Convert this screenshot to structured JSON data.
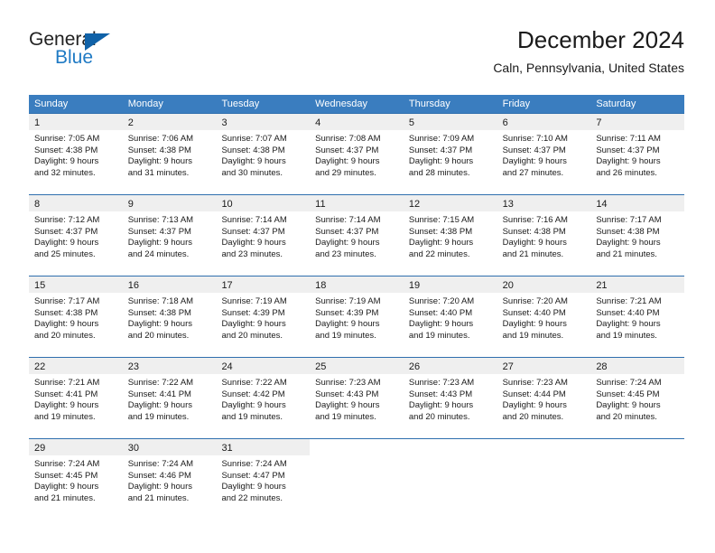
{
  "brand": {
    "name_part1": "General",
    "name_part2": "Blue",
    "triangle_icon": "triangle-logo-icon"
  },
  "header": {
    "title": "December 2024",
    "subtitle": "Caln, Pennsylvania, United States"
  },
  "colors": {
    "header_blue": "#3a7dbf",
    "rule_blue": "#2f6fae",
    "day_band_gray": "#efefef",
    "brand_blue": "#1f7ac4",
    "brand_triangle": "#1062a8",
    "text": "#1a1a1a"
  },
  "weekday_headers": [
    "Sunday",
    "Monday",
    "Tuesday",
    "Wednesday",
    "Thursday",
    "Friday",
    "Saturday"
  ],
  "weeks": [
    [
      {
        "day": "1",
        "sunrise": "Sunrise: 7:05 AM",
        "sunset": "Sunset: 4:38 PM",
        "daylight1": "Daylight: 9 hours",
        "daylight2": "and 32 minutes."
      },
      {
        "day": "2",
        "sunrise": "Sunrise: 7:06 AM",
        "sunset": "Sunset: 4:38 PM",
        "daylight1": "Daylight: 9 hours",
        "daylight2": "and 31 minutes."
      },
      {
        "day": "3",
        "sunrise": "Sunrise: 7:07 AM",
        "sunset": "Sunset: 4:38 PM",
        "daylight1": "Daylight: 9 hours",
        "daylight2": "and 30 minutes."
      },
      {
        "day": "4",
        "sunrise": "Sunrise: 7:08 AM",
        "sunset": "Sunset: 4:37 PM",
        "daylight1": "Daylight: 9 hours",
        "daylight2": "and 29 minutes."
      },
      {
        "day": "5",
        "sunrise": "Sunrise: 7:09 AM",
        "sunset": "Sunset: 4:37 PM",
        "daylight1": "Daylight: 9 hours",
        "daylight2": "and 28 minutes."
      },
      {
        "day": "6",
        "sunrise": "Sunrise: 7:10 AM",
        "sunset": "Sunset: 4:37 PM",
        "daylight1": "Daylight: 9 hours",
        "daylight2": "and 27 minutes."
      },
      {
        "day": "7",
        "sunrise": "Sunrise: 7:11 AM",
        "sunset": "Sunset: 4:37 PM",
        "daylight1": "Daylight: 9 hours",
        "daylight2": "and 26 minutes."
      }
    ],
    [
      {
        "day": "8",
        "sunrise": "Sunrise: 7:12 AM",
        "sunset": "Sunset: 4:37 PM",
        "daylight1": "Daylight: 9 hours",
        "daylight2": "and 25 minutes."
      },
      {
        "day": "9",
        "sunrise": "Sunrise: 7:13 AM",
        "sunset": "Sunset: 4:37 PM",
        "daylight1": "Daylight: 9 hours",
        "daylight2": "and 24 minutes."
      },
      {
        "day": "10",
        "sunrise": "Sunrise: 7:14 AM",
        "sunset": "Sunset: 4:37 PM",
        "daylight1": "Daylight: 9 hours",
        "daylight2": "and 23 minutes."
      },
      {
        "day": "11",
        "sunrise": "Sunrise: 7:14 AM",
        "sunset": "Sunset: 4:37 PM",
        "daylight1": "Daylight: 9 hours",
        "daylight2": "and 23 minutes."
      },
      {
        "day": "12",
        "sunrise": "Sunrise: 7:15 AM",
        "sunset": "Sunset: 4:38 PM",
        "daylight1": "Daylight: 9 hours",
        "daylight2": "and 22 minutes."
      },
      {
        "day": "13",
        "sunrise": "Sunrise: 7:16 AM",
        "sunset": "Sunset: 4:38 PM",
        "daylight1": "Daylight: 9 hours",
        "daylight2": "and 21 minutes."
      },
      {
        "day": "14",
        "sunrise": "Sunrise: 7:17 AM",
        "sunset": "Sunset: 4:38 PM",
        "daylight1": "Daylight: 9 hours",
        "daylight2": "and 21 minutes."
      }
    ],
    [
      {
        "day": "15",
        "sunrise": "Sunrise: 7:17 AM",
        "sunset": "Sunset: 4:38 PM",
        "daylight1": "Daylight: 9 hours",
        "daylight2": "and 20 minutes."
      },
      {
        "day": "16",
        "sunrise": "Sunrise: 7:18 AM",
        "sunset": "Sunset: 4:38 PM",
        "daylight1": "Daylight: 9 hours",
        "daylight2": "and 20 minutes."
      },
      {
        "day": "17",
        "sunrise": "Sunrise: 7:19 AM",
        "sunset": "Sunset: 4:39 PM",
        "daylight1": "Daylight: 9 hours",
        "daylight2": "and 20 minutes."
      },
      {
        "day": "18",
        "sunrise": "Sunrise: 7:19 AM",
        "sunset": "Sunset: 4:39 PM",
        "daylight1": "Daylight: 9 hours",
        "daylight2": "and 19 minutes."
      },
      {
        "day": "19",
        "sunrise": "Sunrise: 7:20 AM",
        "sunset": "Sunset: 4:40 PM",
        "daylight1": "Daylight: 9 hours",
        "daylight2": "and 19 minutes."
      },
      {
        "day": "20",
        "sunrise": "Sunrise: 7:20 AM",
        "sunset": "Sunset: 4:40 PM",
        "daylight1": "Daylight: 9 hours",
        "daylight2": "and 19 minutes."
      },
      {
        "day": "21",
        "sunrise": "Sunrise: 7:21 AM",
        "sunset": "Sunset: 4:40 PM",
        "daylight1": "Daylight: 9 hours",
        "daylight2": "and 19 minutes."
      }
    ],
    [
      {
        "day": "22",
        "sunrise": "Sunrise: 7:21 AM",
        "sunset": "Sunset: 4:41 PM",
        "daylight1": "Daylight: 9 hours",
        "daylight2": "and 19 minutes."
      },
      {
        "day": "23",
        "sunrise": "Sunrise: 7:22 AM",
        "sunset": "Sunset: 4:41 PM",
        "daylight1": "Daylight: 9 hours",
        "daylight2": "and 19 minutes."
      },
      {
        "day": "24",
        "sunrise": "Sunrise: 7:22 AM",
        "sunset": "Sunset: 4:42 PM",
        "daylight1": "Daylight: 9 hours",
        "daylight2": "and 19 minutes."
      },
      {
        "day": "25",
        "sunrise": "Sunrise: 7:23 AM",
        "sunset": "Sunset: 4:43 PM",
        "daylight1": "Daylight: 9 hours",
        "daylight2": "and 19 minutes."
      },
      {
        "day": "26",
        "sunrise": "Sunrise: 7:23 AM",
        "sunset": "Sunset: 4:43 PM",
        "daylight1": "Daylight: 9 hours",
        "daylight2": "and 20 minutes."
      },
      {
        "day": "27",
        "sunrise": "Sunrise: 7:23 AM",
        "sunset": "Sunset: 4:44 PM",
        "daylight1": "Daylight: 9 hours",
        "daylight2": "and 20 minutes."
      },
      {
        "day": "28",
        "sunrise": "Sunrise: 7:24 AM",
        "sunset": "Sunset: 4:45 PM",
        "daylight1": "Daylight: 9 hours",
        "daylight2": "and 20 minutes."
      }
    ],
    [
      {
        "day": "29",
        "sunrise": "Sunrise: 7:24 AM",
        "sunset": "Sunset: 4:45 PM",
        "daylight1": "Daylight: 9 hours",
        "daylight2": "and 21 minutes."
      },
      {
        "day": "30",
        "sunrise": "Sunrise: 7:24 AM",
        "sunset": "Sunset: 4:46 PM",
        "daylight1": "Daylight: 9 hours",
        "daylight2": "and 21 minutes."
      },
      {
        "day": "31",
        "sunrise": "Sunrise: 7:24 AM",
        "sunset": "Sunset: 4:47 PM",
        "daylight1": "Daylight: 9 hours",
        "daylight2": "and 22 minutes."
      },
      {
        "day": "",
        "sunrise": "",
        "sunset": "",
        "daylight1": "",
        "daylight2": ""
      },
      {
        "day": "",
        "sunrise": "",
        "sunset": "",
        "daylight1": "",
        "daylight2": ""
      },
      {
        "day": "",
        "sunrise": "",
        "sunset": "",
        "daylight1": "",
        "daylight2": ""
      },
      {
        "day": "",
        "sunrise": "",
        "sunset": "",
        "daylight1": "",
        "daylight2": ""
      }
    ]
  ]
}
